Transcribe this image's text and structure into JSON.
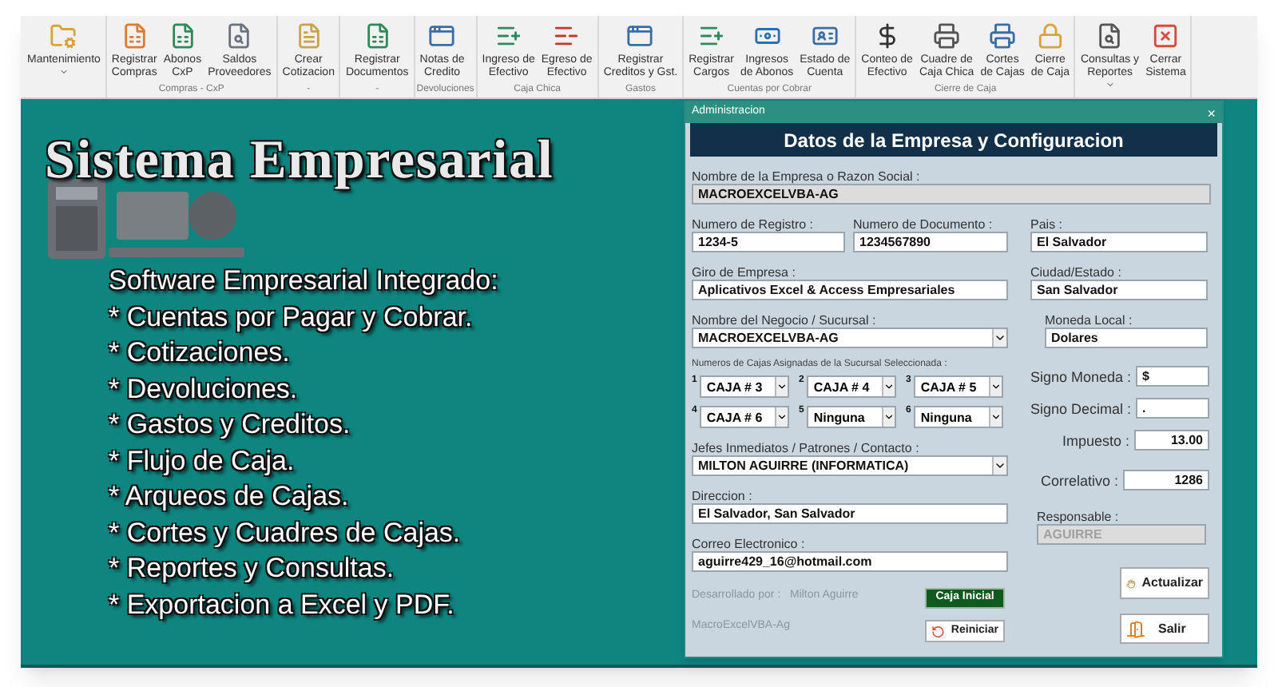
{
  "ribbon": {
    "groups": [
      {
        "buttons": [
          {
            "lines": [
              "Mantenimiento"
            ],
            "dropdown": true
          }
        ]
      },
      {
        "label": "Compras - CxP",
        "buttons": [
          {
            "lines": [
              "Registrar",
              "Compras"
            ],
            "dropdown": false
          },
          {
            "lines": [
              "Abonos",
              "CxP"
            ],
            "dropdown": false
          },
          {
            "lines": [
              "Saldos",
              "Proveedores"
            ],
            "dropdown": false
          }
        ]
      },
      {
        "label": "-",
        "buttons": [
          {
            "lines": [
              "Crear",
              "Cotizacion"
            ],
            "dropdown": false
          }
        ]
      },
      {
        "label": "-",
        "buttons": [
          {
            "lines": [
              "Registrar",
              "Documentos"
            ],
            "dropdown": false
          }
        ]
      },
      {
        "label": "Devoluciones",
        "buttons": [
          {
            "lines": [
              "Notas de",
              "Credito"
            ],
            "dropdown": false
          }
        ]
      },
      {
        "label": "Caja Chica",
        "buttons": [
          {
            "lines": [
              "Ingreso de",
              "Efectivo"
            ],
            "dropdown": false
          },
          {
            "lines": [
              "Egreso de",
              "Efectivo"
            ],
            "dropdown": false
          }
        ]
      },
      {
        "label": "Gastos",
        "buttons": [
          {
            "lines": [
              "Registrar",
              "Creditos y Gst."
            ],
            "dropdown": false
          }
        ]
      },
      {
        "label": "Cuentas por Cobrar",
        "buttons": [
          {
            "lines": [
              "Registrar",
              "Cargos"
            ],
            "dropdown": false
          },
          {
            "lines": [
              "Ingresos",
              "de Abonos"
            ],
            "dropdown": false
          },
          {
            "lines": [
              "Estado de",
              "Cuenta"
            ],
            "dropdown": false
          }
        ]
      },
      {
        "label": "Cierre de Caja",
        "buttons": [
          {
            "lines": [
              "Conteo de",
              "Efectivo"
            ],
            "dropdown": false
          },
          {
            "lines": [
              "Cuadre de",
              "Caja Chica"
            ],
            "dropdown": false
          },
          {
            "lines": [
              "Cortes",
              "de Cajas"
            ],
            "dropdown": false
          },
          {
            "lines": [
              "Cierre",
              "de Caja"
            ],
            "dropdown": false
          }
        ]
      },
      {
        "buttons": [
          {
            "lines": [
              "Consultas y",
              "Reportes"
            ],
            "dropdown": true
          },
          {
            "lines": [
              "Cerrar",
              "Sistema"
            ],
            "dropdown": false
          }
        ]
      }
    ]
  },
  "banner": {
    "title": "Sistema Empresarial",
    "features": [
      "Software Empresarial Integrado:",
      "* Cuentas por Pagar y Cobrar.",
      "* Cotizaciones.",
      "* Devoluciones.",
      "* Gastos y Creditos.",
      "* Flujo de Caja.",
      "* Arqueos de Cajas.",
      "* Cortes y Cuadres de Cajas.",
      "* Reportes y Consultas.",
      "* Exportacion a Excel y PDF."
    ]
  },
  "dialog": {
    "title": "Administracion",
    "close": "×",
    "header": "Datos de la Empresa y Configuracion",
    "company_name": {
      "label": "Nombre de la Empresa o Razon Social :",
      "value": "MACROEXCELVBA-AG",
      "kind": "readonly"
    },
    "registration_number": {
      "label": "Numero de Registro :",
      "value": "1234-5"
    },
    "document_number": {
      "label": "Numero de Documento :",
      "value": "1234567890"
    },
    "country": {
      "label": "Pais  :",
      "value": "El Salvador"
    },
    "business_line": {
      "label": "Giro de Empresa :",
      "value": "Aplicativos Excel & Access Empresariales"
    },
    "city_state": {
      "label": "Ciudad/Estado :",
      "value": "San Salvador"
    },
    "branch": {
      "label": "Nombre del Negocio / Sucursal :",
      "value": "MACROEXCELVBA-AG",
      "kind": "select"
    },
    "currency": {
      "label": "Moneda Local :",
      "value": "Dolares"
    },
    "cash_registers": {
      "label": "Numeros de Cajas Asignadas de la Sucursal Seleccionada :",
      "items": [
        {
          "number": "1",
          "value": "CAJA # 3"
        },
        {
          "number": "2",
          "value": "CAJA # 4"
        },
        {
          "number": "3",
          "value": "CAJA # 5"
        },
        {
          "number": "4",
          "value": "CAJA # 6"
        },
        {
          "number": "5",
          "value": "Ninguna"
        },
        {
          "number": "6",
          "value": "Ninguna"
        }
      ]
    },
    "currency_sign": {
      "label": "Signo Moneda :",
      "value": "$"
    },
    "decimal_sign": {
      "label": "Signo Decimal :",
      "value": "."
    },
    "tax": {
      "label": "Impuesto :",
      "value": "13.00",
      "kind": "number"
    },
    "contacts": {
      "label": "Jefes Inmediatos / Patrones / Contacto :",
      "value": "MILTON AGUIRRE (INFORMATICA)",
      "kind": "select"
    },
    "correlative": {
      "label": "Correlativo :",
      "value": "1286",
      "kind": "number"
    },
    "address": {
      "label": "Direccion :",
      "value": "El Salvador, San Salvador"
    },
    "responsible": {
      "label": "Responsable :",
      "value": "AGUIRRE",
      "kind": "disabled"
    },
    "email": {
      "label": "Correo Electronico :",
      "value": "aguirre429_16@hotmail.com"
    },
    "developed_by": {
      "label": "Desarrollado por :",
      "value": "Milton Aguirre"
    },
    "brand": "MacroExcelVBA-Ag",
    "buttons": {
      "initial_cash": "Caja Inicial",
      "reset": "Reiniciar",
      "update": "Actualizar",
      "exit": "Salir"
    }
  }
}
